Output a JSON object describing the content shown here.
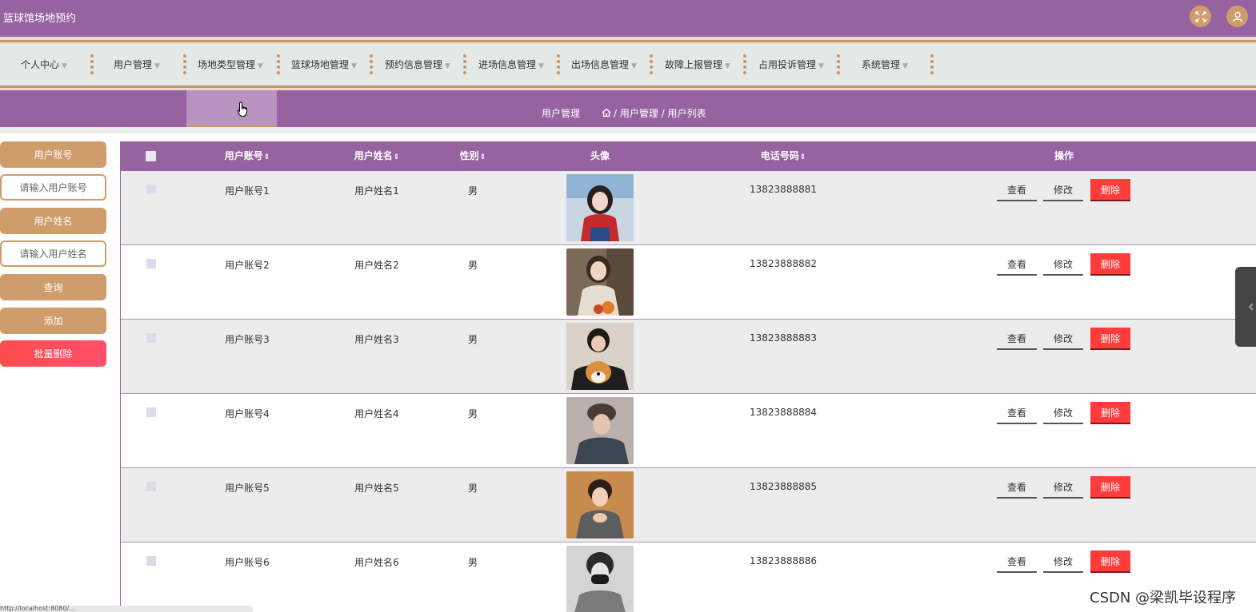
{
  "app": {
    "title": "篮球馆场地预约"
  },
  "topbar": {
    "fullscreen_icon": "fullscreen-icon",
    "user_icon": "user-icon"
  },
  "nav": {
    "items": [
      {
        "label": "个人中心"
      },
      {
        "label": "用户管理"
      },
      {
        "label": "场地类型管理"
      },
      {
        "label": "篮球场地管理"
      },
      {
        "label": "预约信息管理"
      },
      {
        "label": "进场信息管理"
      },
      {
        "label": "出场信息管理"
      },
      {
        "label": "故障上报管理"
      },
      {
        "label": "占用投诉管理"
      },
      {
        "label": "系统管理"
      }
    ]
  },
  "breadcrumb": {
    "title": "用户管理",
    "path": "/ 用户管理 / 用户列表"
  },
  "sidebar": {
    "account_label": "用户账号",
    "account_placeholder": "请输入用户账号",
    "name_label": "用户姓名",
    "name_placeholder": "请输入用户姓名",
    "query_label": "查询",
    "add_label": "添加",
    "batch_delete_label": "批量删除"
  },
  "table": {
    "headers": {
      "account": "用户账号",
      "name": "用户姓名",
      "gender": "性别",
      "avatar": "头像",
      "phone": "电话号码",
      "actions": "操作"
    },
    "rows": [
      {
        "account": "用户账号1",
        "name": "用户姓名1",
        "gender": "男",
        "phone": "13823888881"
      },
      {
        "account": "用户账号2",
        "name": "用户姓名2",
        "gender": "男",
        "phone": "13823888882"
      },
      {
        "account": "用户账号3",
        "name": "用户姓名3",
        "gender": "男",
        "phone": "13823888883"
      },
      {
        "account": "用户账号4",
        "name": "用户姓名4",
        "gender": "男",
        "phone": "13823888884"
      },
      {
        "account": "用户账号5",
        "name": "用户姓名5",
        "gender": "男",
        "phone": "13823888885"
      },
      {
        "account": "用户账号6",
        "name": "用户姓名6",
        "gender": "男",
        "phone": "13823888886"
      }
    ],
    "actions": {
      "view": "查看",
      "edit": "修改",
      "delete": "删除"
    }
  },
  "watermark": "CSDN @梁凯毕设程序",
  "statusbar": {
    "url": "http://localhost:8080/..."
  },
  "colors": {
    "primary": "#9762a0",
    "accent": "#cf9c6b",
    "danger": "#ff3b3b",
    "nav_bg": "#e2e9e7"
  }
}
